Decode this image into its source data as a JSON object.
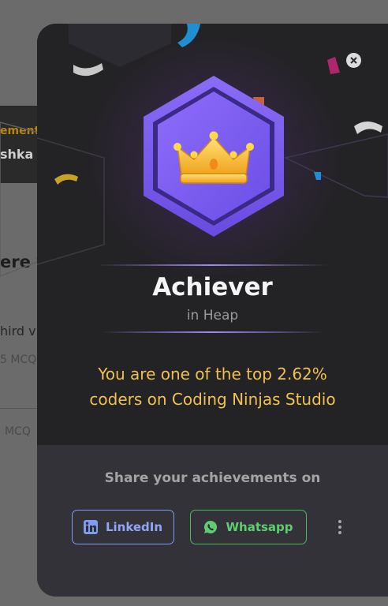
{
  "background": {
    "card_label": "ement",
    "card_name": "shka v",
    "heading": "ere y",
    "line1": "hird v",
    "line2": "5 MCQ",
    "line3": "MCQ"
  },
  "modal": {
    "close_icon": "close-icon",
    "badge_icon": "crown-icon",
    "title": "Achiever",
    "subtitle": "in Heap",
    "message_line1": "You are one of the top 2.62%",
    "message_line2": "coders on Coding Ninjas Studio"
  },
  "share": {
    "title": "Share your achievements on",
    "linkedin_label": "LinkedIn",
    "whatsapp_label": "Whatsapp",
    "more_icon": "more-vertical-icon"
  },
  "colors": {
    "badge_purple": "#7b5cf0",
    "message_gold": "#f1c150",
    "linkedin_blue": "#8fa8f5",
    "whatsapp_green": "#5fce6e"
  }
}
